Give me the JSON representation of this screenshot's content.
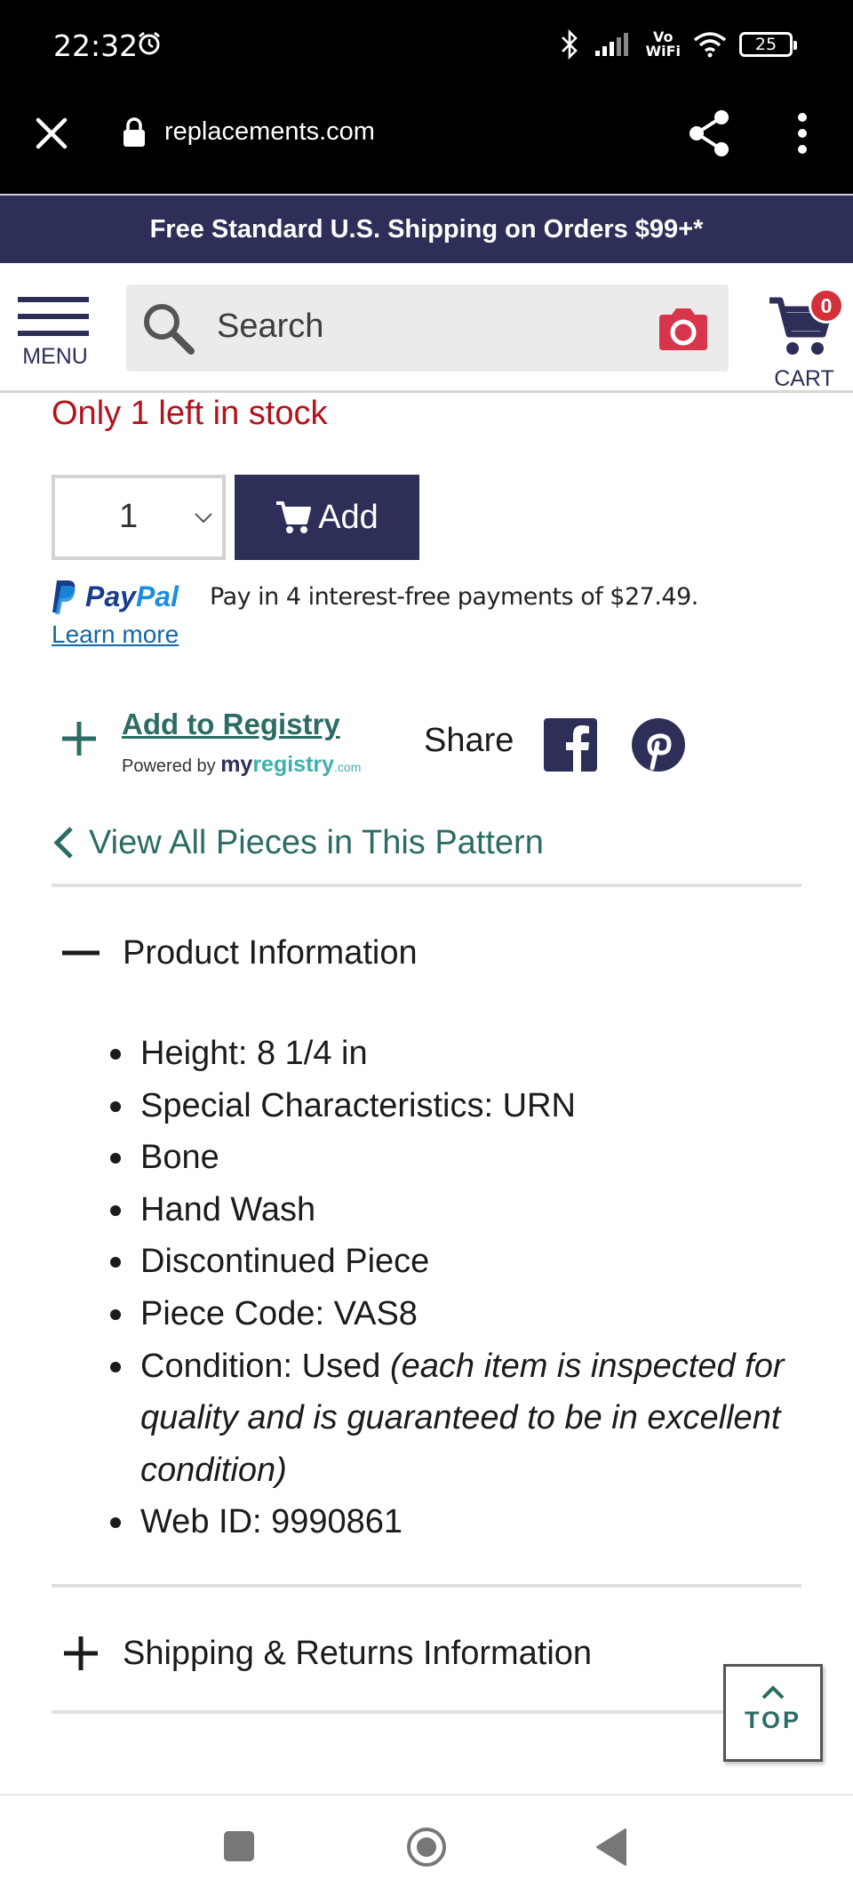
{
  "status_bar": {
    "time": "22:32",
    "network_label": "Vo\nWiFi",
    "battery": "25"
  },
  "browser": {
    "url": "replacements.com"
  },
  "promo": {
    "text": "Free Standard U.S. Shipping on Orders $99+*"
  },
  "header": {
    "menu_label": "MENU",
    "search_placeholder": "Search",
    "cart_label": "CART",
    "cart_count": "0"
  },
  "product": {
    "stock_text": "Only 1 left in stock",
    "quantity": "1",
    "add_label": "Add"
  },
  "paypal": {
    "logo_pay": "Pay",
    "logo_pal": "Pal",
    "message": "Pay in 4 interest-free payments of $27.49.",
    "learn_more": "Learn more"
  },
  "registry": {
    "link": "Add to Registry",
    "powered_by": "Powered by",
    "brand_my": "my",
    "brand_registry": "registry",
    "brand_com": ".com"
  },
  "share": {
    "label": "Share"
  },
  "view_all": {
    "label": "View All Pieces in This Pattern"
  },
  "accordions": {
    "product_info": {
      "title": "Product Information",
      "items": [
        "Height: 8 1/4 in",
        "Special Characteristics: URN",
        "Bone",
        "Hand Wash",
        "Discontinued Piece",
        "Piece Code: VAS8",
        "Condition: Used",
        "Web ID: 9990861"
      ],
      "condition_note": "(each item is inspected for quality and is guaranteed to be in excellent condition)"
    },
    "shipping": {
      "title": "Shipping & Returns Information"
    }
  },
  "top_button": {
    "label": "TOP"
  },
  "colors": {
    "navy": "#2d2f58",
    "teal": "#2c6c64",
    "stock_red": "#b3121b",
    "badge_red": "#d3303a",
    "link_blue": "#1267a8"
  }
}
